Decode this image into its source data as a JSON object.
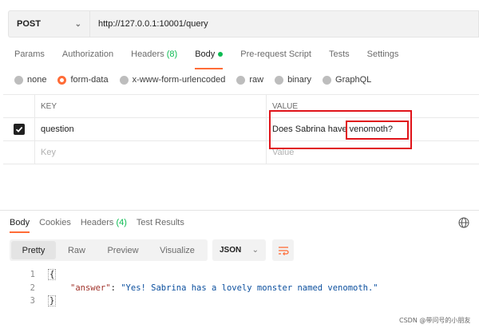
{
  "request": {
    "method": "POST",
    "url": "http://127.0.0.1:10001/query"
  },
  "request_tabs": [
    {
      "label": "Params"
    },
    {
      "label": "Authorization"
    },
    {
      "label": "Headers ",
      "count": "(8)"
    },
    {
      "label": "Body"
    },
    {
      "label": "Pre-request Script"
    },
    {
      "label": "Tests"
    },
    {
      "label": "Settings"
    }
  ],
  "body_types": [
    "none",
    "form-data",
    "x-www-form-urlencoded",
    "raw",
    "binary",
    "GraphQL"
  ],
  "table": {
    "key_header": "KEY",
    "value_header": "VALUE",
    "rows": [
      {
        "key": "question",
        "value": "Does Sabrina have venomoth?"
      }
    ],
    "key_placeholder": "Key",
    "value_placeholder": "Value"
  },
  "response_tabs": [
    {
      "label": "Body"
    },
    {
      "label": "Cookies"
    },
    {
      "label": "Headers ",
      "count": "(4)"
    },
    {
      "label": "Test Results"
    }
  ],
  "view_modes": [
    "Pretty",
    "Raw",
    "Preview",
    "Visualize"
  ],
  "format": "JSON",
  "code": {
    "line_numbers": [
      "1",
      "2",
      "3"
    ],
    "open_brace": "{",
    "close_brace": "}",
    "key": "\"answer\"",
    "colon": ": ",
    "value": "\"Yes! Sabrina has a lovely monster named venomoth.\""
  },
  "watermark": "CSDN @带问号的小朋友",
  "colors": {
    "accent": "#ff6c37",
    "count_green": "#0cbb52",
    "annotation_red": "#e0141a"
  }
}
